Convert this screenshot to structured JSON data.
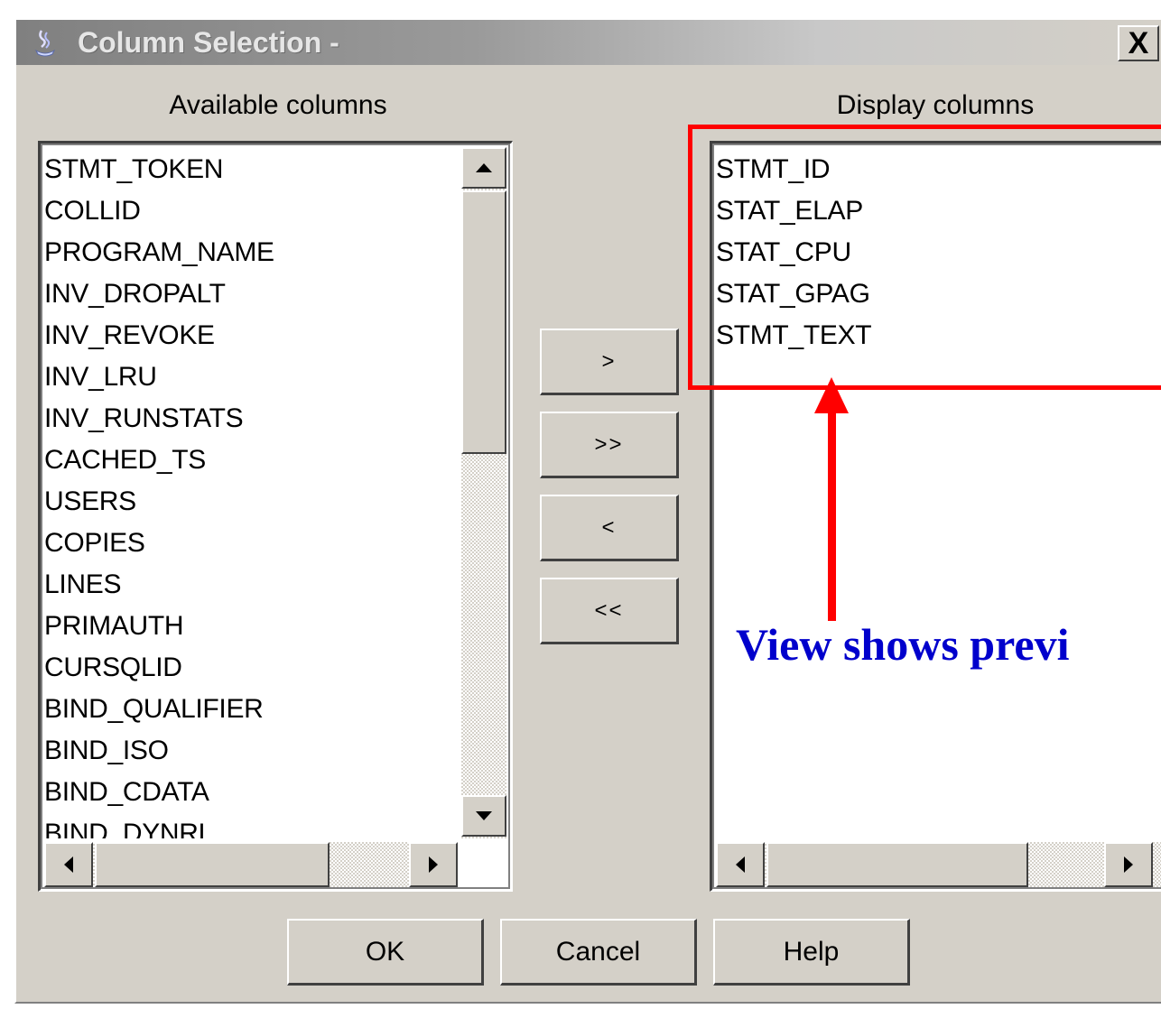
{
  "window": {
    "title": "Column Selection -",
    "close_label": "X",
    "title_icon": "java-cup-icon"
  },
  "available": {
    "header": "Available columns",
    "items": [
      "STMT_TOKEN",
      "COLLID",
      "PROGRAM_NAME",
      "INV_DROPALT",
      "INV_REVOKE",
      "INV_LRU",
      "INV_RUNSTATS",
      "CACHED_TS",
      "USERS",
      "COPIES",
      "LINES",
      "PRIMAUTH",
      "CURSQLID",
      "BIND_QUALIFIER",
      "BIND_ISO",
      "BIND_CDATA",
      "BIND_DYNRL"
    ]
  },
  "display": {
    "header": "Display columns",
    "items": [
      "STMT_ID",
      "STAT_ELAP",
      "STAT_CPU",
      "STAT_GPAG",
      "STMT_TEXT"
    ]
  },
  "move_buttons": {
    "add": ">",
    "add_all": ">>",
    "remove": "<",
    "remove_all": "<<"
  },
  "footer": {
    "ok": "OK",
    "cancel": "Cancel",
    "help": "Help"
  },
  "annotation": {
    "text": "View shows previ",
    "highlight_color": "#ff0000",
    "text_color": "#0000cc"
  }
}
